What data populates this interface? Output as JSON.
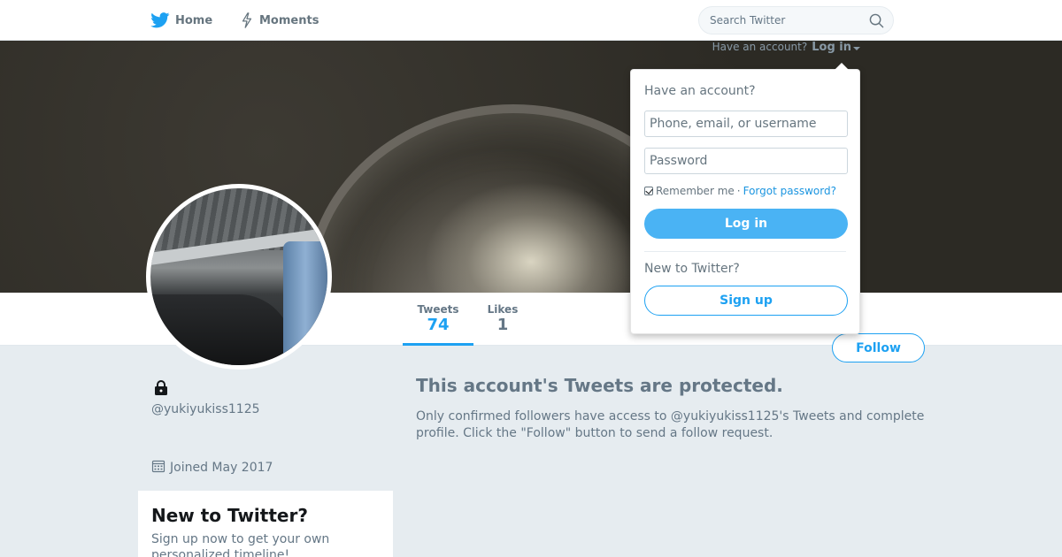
{
  "nav": {
    "home_label": "Home",
    "moments_label": "Moments",
    "search_placeholder": "Search Twitter"
  },
  "login_hint": {
    "prompt": "Have an account?",
    "link": "Log in"
  },
  "profile": {
    "handle": "@yukiyukiss1125",
    "joined": "Joined May 2017",
    "protected": true
  },
  "stats": [
    {
      "label": "Tweets",
      "value": "74",
      "active": true
    },
    {
      "label": "Likes",
      "value": "1",
      "active": false
    }
  ],
  "follow_button": "Follow",
  "protected_message": {
    "title": "This account's Tweets are protected.",
    "body": "Only confirmed followers have access to @yukiyukiss1125's Tweets and complete profile. Click the \"Follow\" button to send a follow request."
  },
  "signup_card": {
    "title": "New to Twitter?",
    "body": "Sign up now to get your own personalized timeline!"
  },
  "login_dropdown": {
    "heading": "Have an account?",
    "username_placeholder": "Phone, email, or username",
    "password_placeholder": "Password",
    "remember_label": "Remember me",
    "separator": "·",
    "forgot_label": "Forgot password?",
    "login_button": "Log in",
    "new_heading": "New to Twitter?",
    "signup_button": "Sign up",
    "remember_checked": true
  },
  "colors": {
    "brand_blue": "#1da1f2",
    "background": "#e6ecf0",
    "muted_text": "#657786"
  },
  "icons": [
    "twitter-bird-icon",
    "lightning-bolt-icon",
    "search-icon",
    "lock-icon",
    "calendar-icon",
    "caret-down-icon"
  ]
}
